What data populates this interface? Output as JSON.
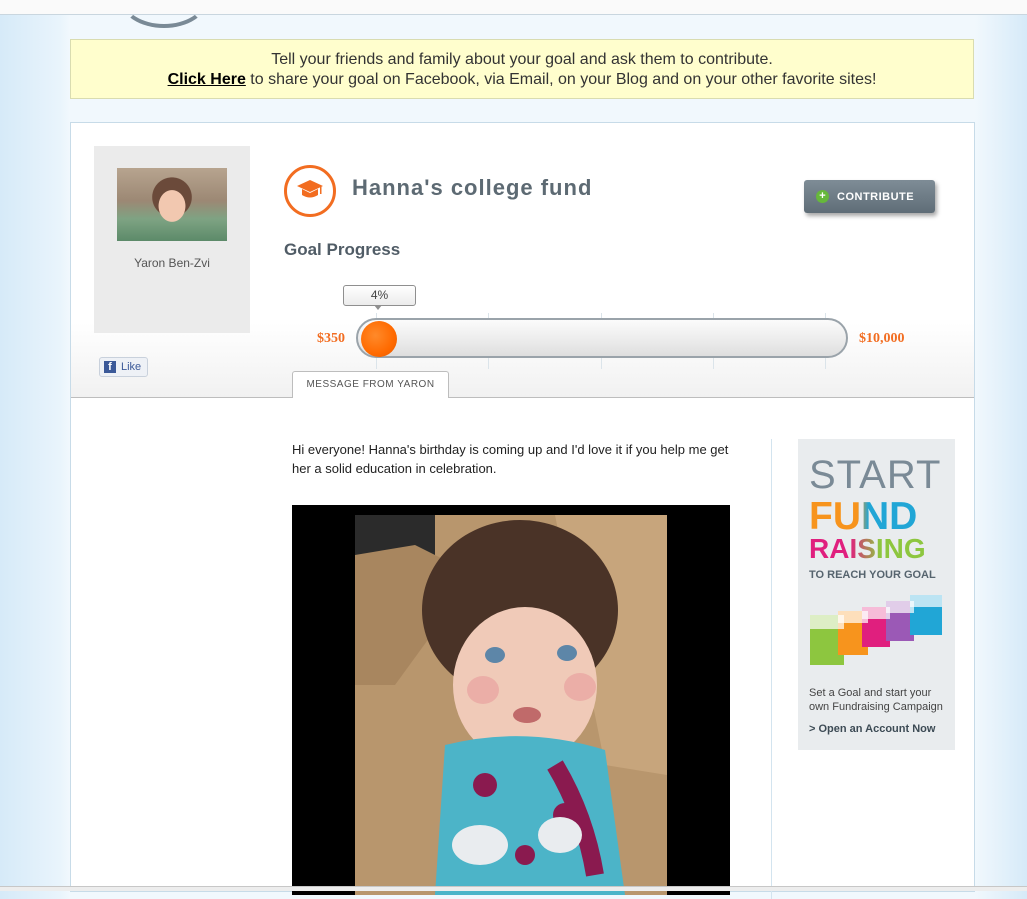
{
  "notice": {
    "line1": "Tell your friends and family about your goal and ask them to contribute.",
    "link_text": "Click Here",
    "line2_rest": " to share your goal on Facebook, via Email, on your Blog and on your other favorite sites!"
  },
  "profile": {
    "name": "Yaron Ben-Zvi",
    "fb_like": "Like"
  },
  "goal": {
    "title": "Hanna's college fund",
    "contribute_label": "CONTRIBUTE",
    "progress_heading": "Goal Progress",
    "percent_label": "4%",
    "progress_fraction": 0.04,
    "raised": "$350",
    "target": "$10,000"
  },
  "tabs": {
    "message_tab": "MESSAGE FROM YARON"
  },
  "message": {
    "text": "Hi everyone! Hanna's birthday is coming up and I'd love it if you help me get her a solid education in celebration."
  },
  "ad": {
    "start": "START",
    "fund": "FUND",
    "raising": "RAISING",
    "reach": "TO REACH YOUR GOAL",
    "cta": "Set a Goal and start your own Fundraising Campaign",
    "open_link": "> Open an Account Now"
  },
  "colors": {
    "accent_orange": "#f26d21",
    "notice_bg": "#fffecd",
    "button_gray": "#6b7882"
  }
}
